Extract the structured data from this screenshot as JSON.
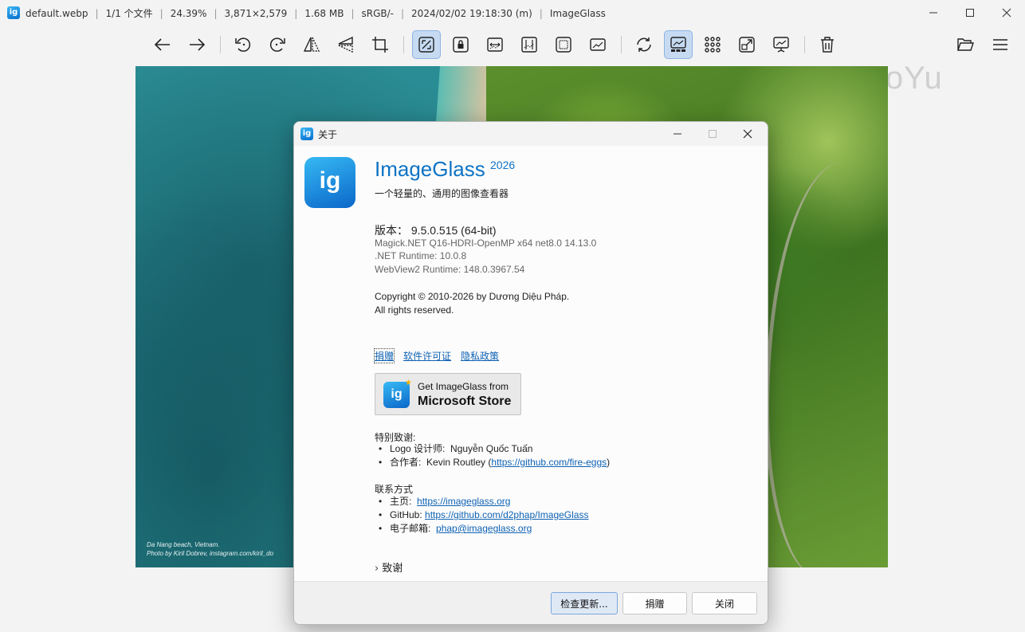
{
  "window": {
    "title_parts": [
      "default.webp",
      "1/1 个文件",
      "24.39%",
      "3,871×2,579",
      "1.68 MB",
      "sRGB/-",
      "2024/02/02 19:18:30 (m)",
      "ImageGlass"
    ],
    "logo_text": "ig"
  },
  "toolbar": {
    "buttons": [
      {
        "name": "previous-image",
        "icon": "arrow-left-icon",
        "active": false
      },
      {
        "name": "next-image",
        "icon": "arrow-right-icon",
        "active": false
      },
      {
        "name": "rotate-left",
        "icon": "rotate-left-icon",
        "active": false
      },
      {
        "name": "rotate-right",
        "icon": "rotate-right-icon",
        "active": false
      },
      {
        "name": "flip-horizontal",
        "icon": "flip-horizontal-icon",
        "active": false
      },
      {
        "name": "flip-vertical",
        "icon": "flip-vertical-icon",
        "active": false
      },
      {
        "name": "crop",
        "icon": "crop-icon",
        "active": false
      },
      {
        "name": "auto-zoom",
        "icon": "auto-zoom-icon",
        "active": true
      },
      {
        "name": "lock-zoom",
        "icon": "lock-zoom-icon",
        "active": false
      },
      {
        "name": "scale-to-width",
        "icon": "scale-width-icon",
        "active": false
      },
      {
        "name": "scale-to-height",
        "icon": "scale-height-icon",
        "active": false
      },
      {
        "name": "scale-to-fit",
        "icon": "scale-fit-icon",
        "active": false
      },
      {
        "name": "scale-to-fill",
        "icon": "scale-fill-icon",
        "active": false
      },
      {
        "name": "refresh",
        "icon": "refresh-icon",
        "active": false
      },
      {
        "name": "toggle-gallery",
        "icon": "gallery-icon",
        "active": true
      },
      {
        "name": "checkerboard",
        "icon": "grid-icon",
        "active": false
      },
      {
        "name": "fullscreen",
        "icon": "fullscreen-icon",
        "active": false
      },
      {
        "name": "slideshow",
        "icon": "slideshow-icon",
        "active": false
      },
      {
        "name": "delete",
        "icon": "trash-icon",
        "active": false
      },
      {
        "name": "open-file",
        "icon": "folder-open-icon",
        "active": false
      },
      {
        "name": "main-menu",
        "icon": "hamburger-menu-icon",
        "active": false
      }
    ],
    "watermark": "WaMoYu"
  },
  "viewer": {
    "caption_line1": "Da Nang beach, Vietnam.",
    "caption_line2": "Photo by Kiril Dobrev, instagram.com/kiril_do"
  },
  "dialog": {
    "title": "关于",
    "app_name": "ImageGlass",
    "app_year": "2026",
    "tagline": "一个轻量的、通用的图像查看器",
    "version_label": "版本：",
    "version_value": "9.5.0.515 (64-bit)",
    "magick": "Magick.NET Q16-HDRI-OpenMP x64 net8.0 14.13.0",
    "dotnet": ".NET Runtime: 10.0.8",
    "webview": "WebView2 Runtime: 148.0.3967.54",
    "copyright": "Copyright © 2010-2026 by Dương Diệu Pháp.",
    "rights": "All rights reserved.",
    "links": {
      "donate": "捐赠",
      "license": "软件许可证",
      "privacy": "隐私政策"
    },
    "store": {
      "line1": "Get ImageGlass from",
      "line2": "Microsoft Store"
    },
    "special_thanks": {
      "heading": "特别致谢:",
      "logo_label": "Logo 设计师:",
      "logo_name": "Nguyễn Quốc Tuấn",
      "collab_label": "合作者:",
      "collab_name": "Kevin Routley (",
      "collab_url": "https://github.com/fire-eggs",
      "collab_close": ")"
    },
    "contact": {
      "heading": "联系方式",
      "home_label": "主页:",
      "home_url": "https://imageglass.org",
      "github_label": "GitHub:",
      "github_url": "https://github.com/d2phap/ImageGlass",
      "email_label": "电子邮箱:",
      "email_url": "phap@imageglass.org"
    },
    "acknowledgements": "致谢",
    "buttons": {
      "check_update": "检查更新...",
      "donate": "捐赠",
      "close": "关闭"
    }
  },
  "colors": {
    "accent": "#0e73c5",
    "link": "#0e62b3",
    "toolbar_active": "#c6dbf2"
  }
}
